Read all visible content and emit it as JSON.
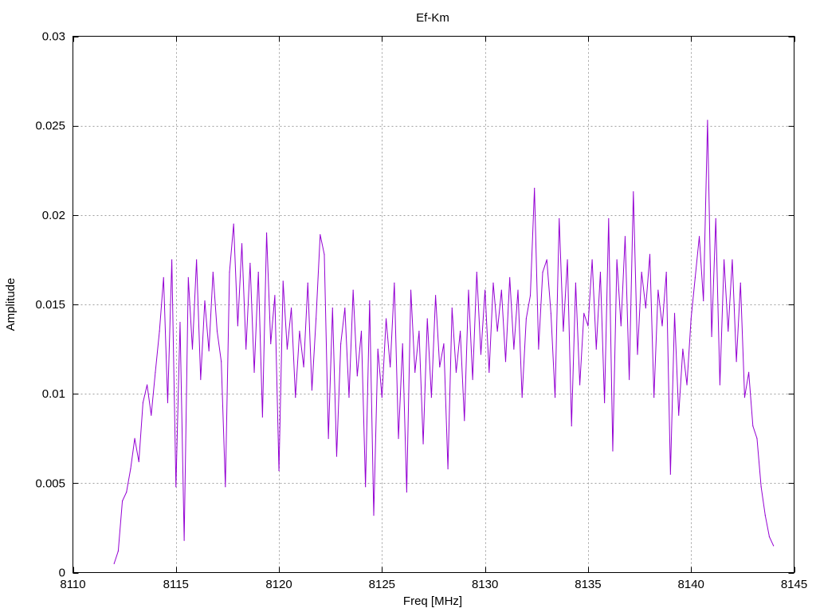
{
  "chart_data": {
    "type": "line",
    "title": "Ef-Km",
    "xlabel": "Freq [MHz]",
    "ylabel": "Amplitude",
    "xlim": [
      8110,
      8145
    ],
    "ylim": [
      0,
      0.03
    ],
    "grid": true,
    "legend": "none",
    "x_ticks": [
      {
        "value": 8110,
        "label": "8110"
      },
      {
        "value": 8115,
        "label": "8115"
      },
      {
        "value": 8120,
        "label": "8120"
      },
      {
        "value": 8125,
        "label": "8125"
      },
      {
        "value": 8130,
        "label": "8130"
      },
      {
        "value": 8135,
        "label": "8135"
      },
      {
        "value": 8140,
        "label": "8140"
      },
      {
        "value": 8145,
        "label": "8145"
      }
    ],
    "y_ticks": [
      {
        "value": 0,
        "label": "0"
      },
      {
        "value": 0.005,
        "label": "0.005"
      },
      {
        "value": 0.01,
        "label": "0.01"
      },
      {
        "value": 0.015,
        "label": "0.015"
      },
      {
        "value": 0.02,
        "label": "0.02"
      },
      {
        "value": 0.025,
        "label": "0.025"
      },
      {
        "value": 0.03,
        "label": "0.03"
      }
    ],
    "series": [
      {
        "color": "#9400d3",
        "x": [
          8112.0,
          8112.2,
          8112.4,
          8112.6,
          8112.8,
          8113.0,
          8113.2,
          8113.4,
          8113.6,
          8113.8,
          8114.0,
          8114.2,
          8114.4,
          8114.6,
          8114.8,
          8115.0,
          8115.2,
          8115.4,
          8115.6,
          8115.8,
          8116.0,
          8116.2,
          8116.4,
          8116.6,
          8116.8,
          8117.0,
          8117.2,
          8117.4,
          8117.6,
          8117.8,
          8118.0,
          8118.2,
          8118.4,
          8118.6,
          8118.8,
          8119.0,
          8119.2,
          8119.4,
          8119.6,
          8119.8,
          8120.0,
          8120.2,
          8120.4,
          8120.6,
          8120.8,
          8121.0,
          8121.2,
          8121.4,
          8121.6,
          8121.8,
          8122.0,
          8122.2,
          8122.4,
          8122.6,
          8122.8,
          8123.0,
          8123.2,
          8123.4,
          8123.6,
          8123.8,
          8124.0,
          8124.2,
          8124.4,
          8124.6,
          8124.8,
          8125.0,
          8125.2,
          8125.4,
          8125.6,
          8125.8,
          8126.0,
          8126.2,
          8126.4,
          8126.6,
          8126.8,
          8127.0,
          8127.2,
          8127.4,
          8127.6,
          8127.8,
          8128.0,
          8128.2,
          8128.4,
          8128.6,
          8128.8,
          8129.0,
          8129.2,
          8129.4,
          8129.6,
          8129.8,
          8130.0,
          8130.2,
          8130.4,
          8130.6,
          8130.8,
          8131.0,
          8131.2,
          8131.4,
          8131.6,
          8131.8,
          8132.0,
          8132.2,
          8132.4,
          8132.6,
          8132.8,
          8133.0,
          8133.2,
          8133.4,
          8133.6,
          8133.8,
          8134.0,
          8134.2,
          8134.4,
          8134.6,
          8134.8,
          8135.0,
          8135.2,
          8135.4,
          8135.6,
          8135.8,
          8136.0,
          8136.2,
          8136.4,
          8136.6,
          8136.8,
          8137.0,
          8137.2,
          8137.4,
          8137.6,
          8137.8,
          8138.0,
          8138.2,
          8138.4,
          8138.6,
          8138.8,
          8139.0,
          8139.2,
          8139.4,
          8139.6,
          8139.8,
          8140.0,
          8140.2,
          8140.4,
          8140.6,
          8140.8,
          8141.0,
          8141.2,
          8141.4,
          8141.6,
          8141.8,
          8142.0,
          8142.2,
          8142.4,
          8142.6,
          8142.8,
          8143.0,
          8143.2,
          8143.4,
          8143.6,
          8143.8,
          8144.0
        ],
        "y": [
          0.0005,
          0.0012,
          0.004,
          0.0045,
          0.0058,
          0.0075,
          0.0062,
          0.0095,
          0.0105,
          0.0088,
          0.0112,
          0.0135,
          0.0165,
          0.0095,
          0.0175,
          0.0048,
          0.014,
          0.0018,
          0.0165,
          0.0125,
          0.0175,
          0.0108,
          0.0152,
          0.0124,
          0.0168,
          0.0135,
          0.0118,
          0.0048,
          0.0168,
          0.0195,
          0.0138,
          0.0184,
          0.0125,
          0.0173,
          0.0112,
          0.0168,
          0.0087,
          0.019,
          0.0128,
          0.0155,
          0.0057,
          0.0163,
          0.0125,
          0.0148,
          0.0098,
          0.0135,
          0.0115,
          0.0162,
          0.0102,
          0.0142,
          0.0189,
          0.0178,
          0.0075,
          0.0148,
          0.0065,
          0.0128,
          0.0148,
          0.0098,
          0.0158,
          0.011,
          0.0135,
          0.0048,
          0.0152,
          0.0032,
          0.0125,
          0.0098,
          0.0142,
          0.0115,
          0.0162,
          0.0075,
          0.0128,
          0.0045,
          0.0158,
          0.0112,
          0.0135,
          0.0072,
          0.0142,
          0.0098,
          0.0155,
          0.0115,
          0.0128,
          0.0058,
          0.0148,
          0.0112,
          0.0135,
          0.0085,
          0.0158,
          0.0108,
          0.0168,
          0.0122,
          0.0158,
          0.0112,
          0.0162,
          0.0135,
          0.0158,
          0.0118,
          0.0165,
          0.0125,
          0.0158,
          0.0098,
          0.0142,
          0.0155,
          0.0215,
          0.0125,
          0.0168,
          0.0175,
          0.0145,
          0.0098,
          0.0198,
          0.0135,
          0.0175,
          0.0082,
          0.0162,
          0.0105,
          0.0145,
          0.0138,
          0.0175,
          0.0125,
          0.0168,
          0.0095,
          0.0198,
          0.0068,
          0.0175,
          0.0138,
          0.0188,
          0.0108,
          0.0213,
          0.0122,
          0.0168,
          0.0148,
          0.0178,
          0.0098,
          0.0158,
          0.0138,
          0.0168,
          0.0055,
          0.0145,
          0.0088,
          0.0125,
          0.0105,
          0.0142,
          0.0165,
          0.0188,
          0.0152,
          0.0253,
          0.0132,
          0.0198,
          0.0105,
          0.0175,
          0.0135,
          0.0175,
          0.0118,
          0.0162,
          0.0098,
          0.0112,
          0.0082,
          0.0075,
          0.0048,
          0.0032,
          0.002,
          0.0015
        ]
      }
    ]
  }
}
